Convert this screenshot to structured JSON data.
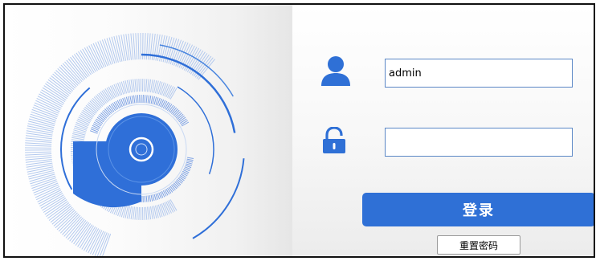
{
  "login": {
    "username_value": "admin",
    "password_value": "",
    "login_label": "登录",
    "reset_password_label": "重置密码"
  },
  "icons": {
    "user": "user-icon",
    "lock": "unlock-icon"
  },
  "colors": {
    "accent": "#2f70d6",
    "field_border": "#5b87c6",
    "graphic_blue": "#2f6fd8",
    "graphic_light": "#b3c9ee"
  }
}
